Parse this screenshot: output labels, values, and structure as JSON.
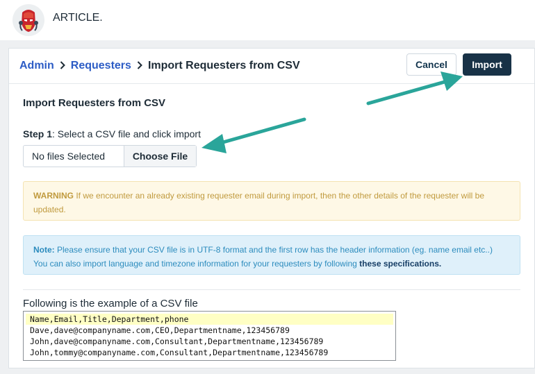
{
  "app": {
    "brand": "ARTICLE."
  },
  "breadcrumb": {
    "items": [
      {
        "label": "Admin"
      },
      {
        "label": "Requesters"
      },
      {
        "label": "Import Requesters from CSV"
      }
    ]
  },
  "actions": {
    "cancel_label": "Cancel",
    "import_label": "Import"
  },
  "form": {
    "title": "Import Requesters from CSV",
    "step_prefix": "Step 1",
    "step_text": ": Select a CSV file and click import",
    "file_status": "No files Selected",
    "choose_file_label": "Choose File"
  },
  "warning": {
    "label": "WARNING",
    "text": " If we encounter an already existing requester email during import, then the other details of the requester will be updated."
  },
  "note": {
    "label": "Note:",
    "line1": " Please ensure that your CSV file is in UTF-8 format and the first row has the header information (eg. name email etc..)",
    "line2": "You can also import language and timezone information for your requesters by following ",
    "link": "these specifications."
  },
  "example": {
    "title": "Following is the example of a CSV file",
    "rows": [
      "Name,Email,Title,Department,phone",
      "Dave,dave@companyname.com,CEO,Departmentname,123456789",
      "John,dave@companyname.com,Consultant,Departmentname,123456789",
      "John,tommy@companyname.com,Consultant,Departmentname,123456789"
    ]
  },
  "colors": {
    "primary": "#183247",
    "link": "#2c5cc5",
    "arrow": "#2aa59a",
    "warning_bg": "#fef8e6",
    "note_bg": "#dff0fa"
  }
}
